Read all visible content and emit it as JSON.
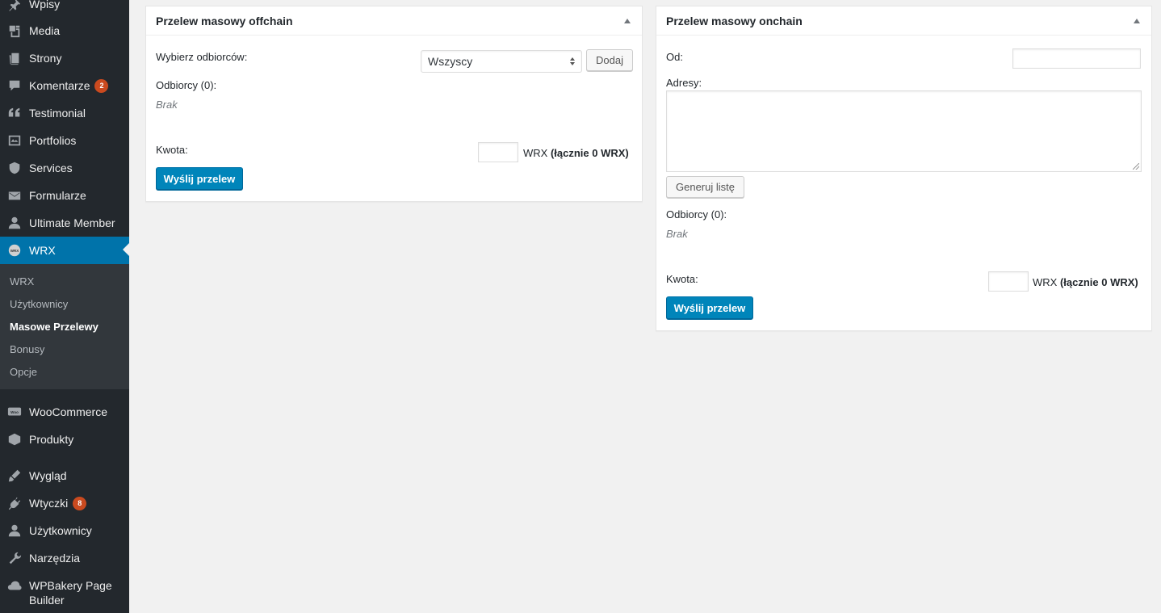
{
  "sidebar": {
    "items": [
      {
        "label": "Wpisy",
        "icon": "pin-icon"
      },
      {
        "label": "Media",
        "icon": "media-icon"
      },
      {
        "label": "Strony",
        "icon": "page-icon"
      },
      {
        "label": "Komentarze",
        "icon": "comment-icon",
        "badge": "2"
      },
      {
        "label": "Testimonial",
        "icon": "quote-icon"
      },
      {
        "label": "Portfolios",
        "icon": "portfolio-icon"
      },
      {
        "label": "Services",
        "icon": "shield-icon"
      },
      {
        "label": "Formularze",
        "icon": "email-icon"
      },
      {
        "label": "Ultimate Member",
        "icon": "user-icon"
      },
      {
        "label": "WRX",
        "icon": "wrx-icon"
      },
      {
        "label": "WooCommerce",
        "icon": "woo-icon"
      },
      {
        "label": "Produkty",
        "icon": "box-icon"
      },
      {
        "label": "Wygląd",
        "icon": "brush-icon"
      },
      {
        "label": "Wtyczki",
        "icon": "plugin-icon",
        "badge": "8"
      },
      {
        "label": "Użytkownicy",
        "icon": "user-icon"
      },
      {
        "label": "Narzędzia",
        "icon": "wrench-icon"
      },
      {
        "label": "WPBakery Page",
        "label2": "Builder",
        "icon": "cloud-icon"
      }
    ],
    "submenu": [
      "WRX",
      "Użytkownicy",
      "Masowe Przelewy",
      "Bonusy",
      "Opcje"
    ]
  },
  "offchain": {
    "title": "Przelew masowy offchain",
    "recipients_label": "Wybierz odbiorców:",
    "select_value": "Wszyscy",
    "add_button": "Dodaj",
    "recipients_count": "Odbiorcy (0):",
    "empty": "Brak",
    "amount_label": "Kwota:",
    "currency": "WRX",
    "total": "(łącznie 0 WRX)",
    "submit": "Wyślij przelew"
  },
  "onchain": {
    "title": "Przelew masowy onchain",
    "from_label": "Od:",
    "addresses_label": "Adresy:",
    "generate_button": "Generuj listę",
    "recipients_count": "Odbiorcy (0):",
    "empty": "Brak",
    "amount_label": "Kwota:",
    "currency": "WRX",
    "total": "(łącznie 0 WRX)",
    "submit": "Wyślij przelew"
  }
}
